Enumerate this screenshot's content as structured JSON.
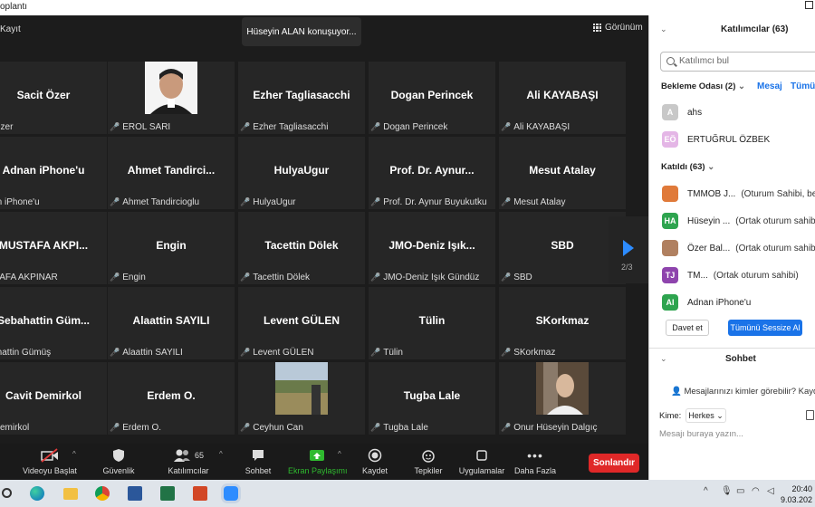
{
  "window": {
    "title": "oplantı"
  },
  "meeting": {
    "recording_label": "Kayıt",
    "speaking_banner": "Hüseyin ALAN konuşuyor...",
    "view_label": "Görünüm",
    "page_indicator": "2/3",
    "tiles": [
      {
        "big": "Sacit Özer",
        "small": "cit Özer",
        "mic": false
      },
      {
        "big": "",
        "small": "EROL SARI",
        "mic": true,
        "photo": true
      },
      {
        "big": "Ezher Tagliasacchi",
        "small": "Ezher Tagliasacchi",
        "mic": true
      },
      {
        "big": "Dogan Perincek",
        "small": "Dogan Perincek",
        "mic": true
      },
      {
        "big": "Ali KAYABAŞI",
        "small": "Ali KAYABAŞI",
        "mic": true
      },
      {
        "big": "Adnan iPhone'u",
        "small": "dnan iPhone'u",
        "mic": false
      },
      {
        "big": "Ahmet Tandirci...",
        "small": "Ahmet Tandircioglu",
        "mic": true
      },
      {
        "big": "HulyaUgur",
        "small": "HulyaUgur",
        "mic": true
      },
      {
        "big": "Prof. Dr. Aynur...",
        "small": "Prof. Dr. Aynur Buyukutku",
        "mic": true
      },
      {
        "big": "Mesut Atalay",
        "small": "Mesut Atalay",
        "mic": true
      },
      {
        "big": "MUSTAFA AKPI...",
        "small": "USTAFA AKPINAR",
        "mic": false
      },
      {
        "big": "Engin",
        "small": "Engin",
        "mic": true
      },
      {
        "big": "Tacettin Dölek",
        "small": "Tacettin Dölek",
        "mic": true
      },
      {
        "big": "JMO-Deniz Işık...",
        "small": "JMO-Deniz Işık Gündüz",
        "mic": true
      },
      {
        "big": "SBD",
        "small": "SBD",
        "mic": true
      },
      {
        "big": "Sebahattin Güm...",
        "small": "ebahattin Gümüş",
        "mic": false
      },
      {
        "big": "Alaattin SAYILI",
        "small": "Alaattin SAYILI",
        "mic": true
      },
      {
        "big": "Levent GÜLEN",
        "small": "Levent GÜLEN",
        "mic": true
      },
      {
        "big": "Tülin",
        "small": "Tülin",
        "mic": true
      },
      {
        "big": "SKorkmaz",
        "small": "SKorkmaz",
        "mic": true
      },
      {
        "big": "Cavit Demirkol",
        "small": "vit Demirkol",
        "mic": false
      },
      {
        "big": "Erdem O.",
        "small": "Erdem O.",
        "mic": true
      },
      {
        "big": "",
        "small": "Ceyhun Can",
        "mic": true,
        "photo": true
      },
      {
        "big": "Tugba Lale",
        "small": "Tugba Lale",
        "mic": true
      },
      {
        "big": "",
        "small": "Onur Hüseyin Dalgıç",
        "mic": true,
        "photo": true
      }
    ]
  },
  "toolbar": {
    "video": "Videoyu Başlat",
    "security": "Güvenlik",
    "participants": "Katılımcılar",
    "participants_count": "65",
    "chat": "Sohbet",
    "share": "Ekran Paylaşımı",
    "record": "Kaydet",
    "reactions": "Tepkiler",
    "apps": "Uygulamalar",
    "more": "Daha Fazla",
    "end": "Sonlandır"
  },
  "panel": {
    "title": "Katılımcılar (63)",
    "search_placeholder": "Katılımcı bul",
    "waiting_header": "Bekleme Odası (2)",
    "message_link": "Mesaj",
    "admit_all_link": "Tümü",
    "waiting": [
      {
        "initials": "A",
        "name": "ahs",
        "color": "#c8c8c8"
      },
      {
        "initials": "EÖ",
        "name": "ERTUĞRUL ÖZBEK",
        "color": "#e4b6e6"
      }
    ],
    "joined_header": "Katıldı (63)",
    "joined": [
      {
        "initials": "",
        "name": "TMMOB J...",
        "role": "(Oturum Sahibi, ben)",
        "color": "#e07a3a"
      },
      {
        "initials": "HA",
        "name": "Hüseyin ...",
        "role": "(Ortak oturum sahibi)",
        "color": "#2ea44f"
      },
      {
        "initials": "",
        "name": "Özer Bal...",
        "role": "(Ortak oturum sahibi)",
        "color": "#b08060"
      },
      {
        "initials": "TJ",
        "name": "TM...",
        "role": "(Ortak oturum sahibi)",
        "color": "#8e44ad"
      },
      {
        "initials": "AI",
        "name": "Adnan iPhone'u",
        "role": "",
        "color": "#2ea44f"
      }
    ],
    "invite_button": "Davet et",
    "mute_all_button": "Tümünü Sessize Al",
    "chat_title": "Sohbet",
    "who_can_see": "Mesajlarınızı kimler görebilir? Kaydetm",
    "to_label": "Kime:",
    "to_value": "Herkes",
    "message_placeholder": "Mesajı buraya yazın..."
  },
  "taskbar": {
    "time": "20:40",
    "date": "9.03.202"
  }
}
